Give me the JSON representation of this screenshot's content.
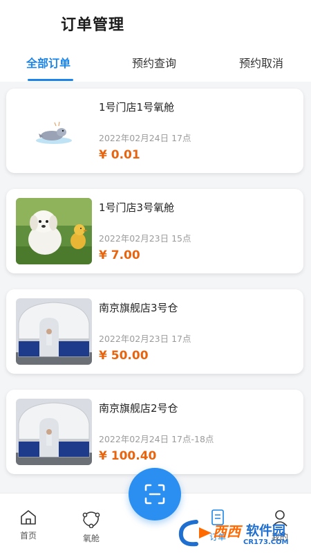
{
  "header": {
    "title": "订单管理"
  },
  "tabs": [
    {
      "label": "全部订单",
      "active": true
    },
    {
      "label": "预约查询",
      "active": false
    },
    {
      "label": "预约取消",
      "active": false
    }
  ],
  "orders": [
    {
      "title": "1号门店1号氧舱",
      "time": "2022年02月24日 17点",
      "price": "¥ 0.01",
      "thumb": "cartoon-seal-image"
    },
    {
      "title": "1号门店3号氧舱",
      "time": "2022年02月23日 15点",
      "price": "¥ 7.00",
      "thumb": "puppy-and-duckling-photo"
    },
    {
      "title": "南京旗舰店3号仓",
      "time": "2022年02月23日 17点",
      "price": "¥ 50.00",
      "thumb": "oxygen-chamber-photo"
    },
    {
      "title": "南京旗舰店2号仓",
      "time": "2022年02月24日 17点-18点",
      "price": "¥ 100.40",
      "thumb": "oxygen-chamber-photo"
    }
  ],
  "bottom_nav": [
    {
      "label": "首页",
      "icon": "home-icon"
    },
    {
      "label": "氧舱",
      "icon": "network-icon"
    },
    {
      "label": "订单",
      "icon": "order-icon"
    },
    {
      "label": "我的",
      "icon": "user-icon"
    }
  ],
  "fab": {
    "icon": "scan-icon"
  },
  "watermark": {
    "text_1": "西西",
    "text_2": "软件园",
    "url": "CR173.COM"
  },
  "colors": {
    "accent": "#1a84e8",
    "price": "#e8650f",
    "background": "#f4f5f7"
  }
}
